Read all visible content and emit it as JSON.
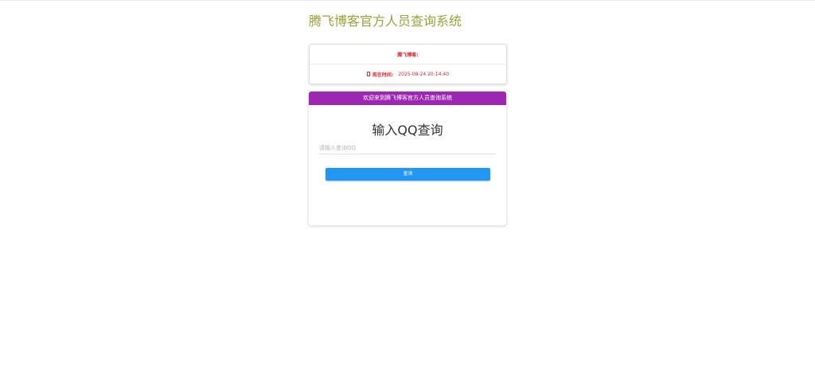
{
  "page": {
    "title": "腾飞博客官方人员查询系统"
  },
  "info": {
    "blog_label": "腾飞博客:",
    "time_label": "现在时间:",
    "time_value": "2025-08-24 20:14:40",
    "icon": "clock-icon",
    "color": "#d9262c"
  },
  "query_card": {
    "header": "欢迎来到腾飞博客官方人员查询系统",
    "header_color": "#9c27b0",
    "title": "输入QQ查询",
    "input_placeholder": "请输入查询QQ",
    "input_value": "",
    "button_label": "查询",
    "button_color": "#2196f3"
  }
}
